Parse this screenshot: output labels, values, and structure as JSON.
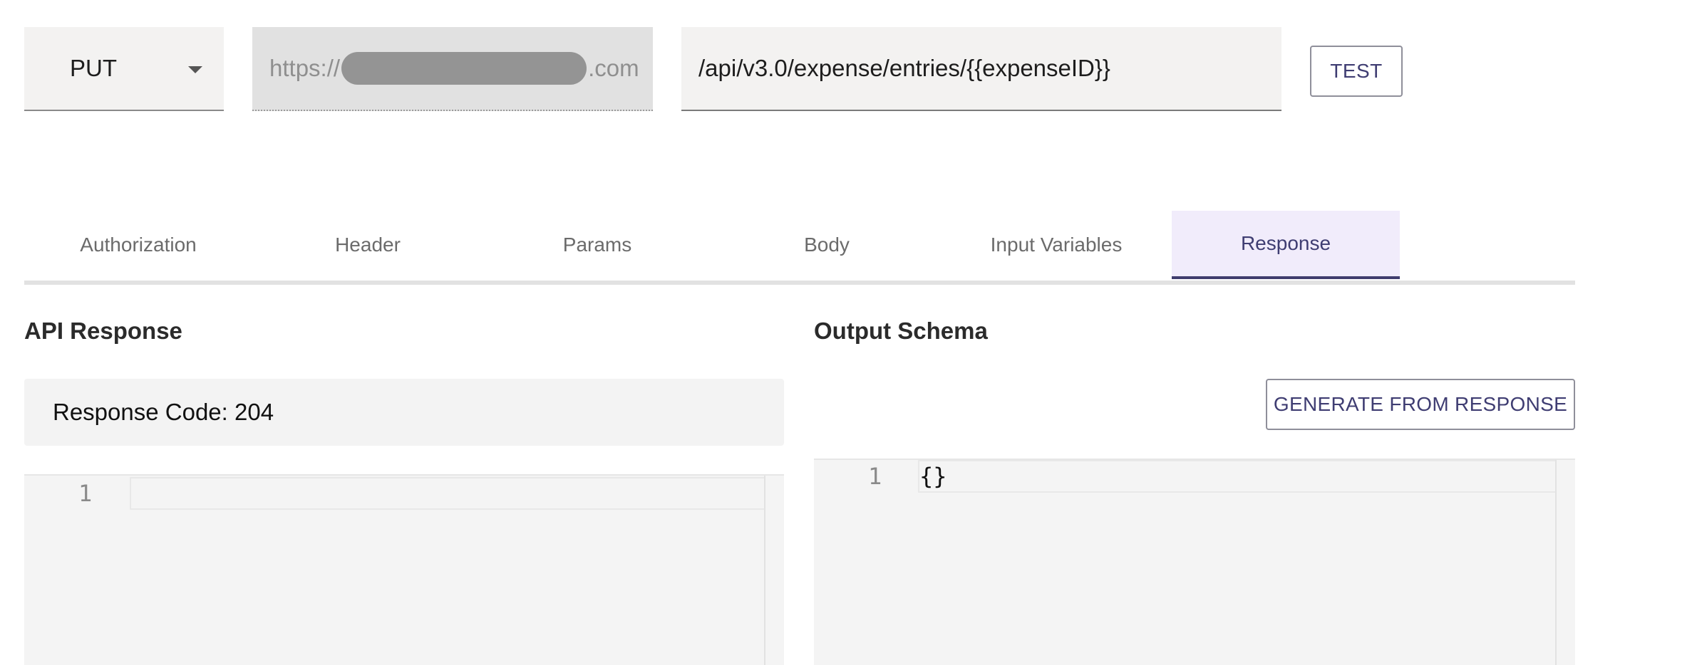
{
  "request": {
    "method": "PUT",
    "base_url_prefix": "https://",
    "base_url_suffix": ".com",
    "path": "/api/v3.0/expense/entries/{{expenseID}}",
    "test_label": "TEST"
  },
  "tabs": [
    {
      "label": "Authorization"
    },
    {
      "label": "Header"
    },
    {
      "label": "Params"
    },
    {
      "label": "Body"
    },
    {
      "label": "Input Variables"
    },
    {
      "label": "Response",
      "active": true
    }
  ],
  "api_response": {
    "title": "API Response",
    "response_code": "Response Code: 204",
    "editor_line_number": "1",
    "editor_content": ""
  },
  "output_schema": {
    "title": "Output Schema",
    "generate_label": "GENERATE FROM RESPONSE",
    "editor_line_number": "1",
    "editor_content": "{}"
  },
  "colors": {
    "accent": "#3f3d72",
    "active_tab_bg": "#f1ecfb",
    "field_bg": "#f3f2f1"
  }
}
